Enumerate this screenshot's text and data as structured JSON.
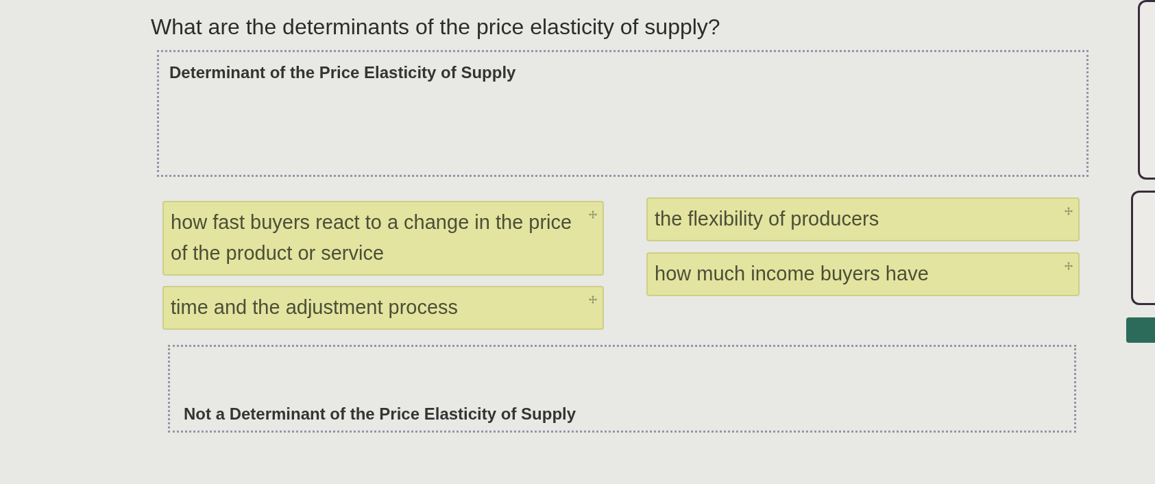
{
  "question": "What are the determinants of the price elasticity of supply?",
  "drop_zones": [
    {
      "label": "Determinant of the Price Elasticity of Supply",
      "kind": "label-top"
    },
    {
      "label": "Not a Determinant of the Price Elasticity of Supply",
      "kind": "label-bottom"
    }
  ],
  "answer_columns": [
    {
      "cards": [
        {
          "text": "how fast buyers react to a change in the price of the product or service"
        },
        {
          "text": "time and the adjustment process"
        }
      ]
    },
    {
      "cards": [
        {
          "text": "the flexibility of producers"
        },
        {
          "text": "how much income buyers have"
        }
      ]
    }
  ]
}
